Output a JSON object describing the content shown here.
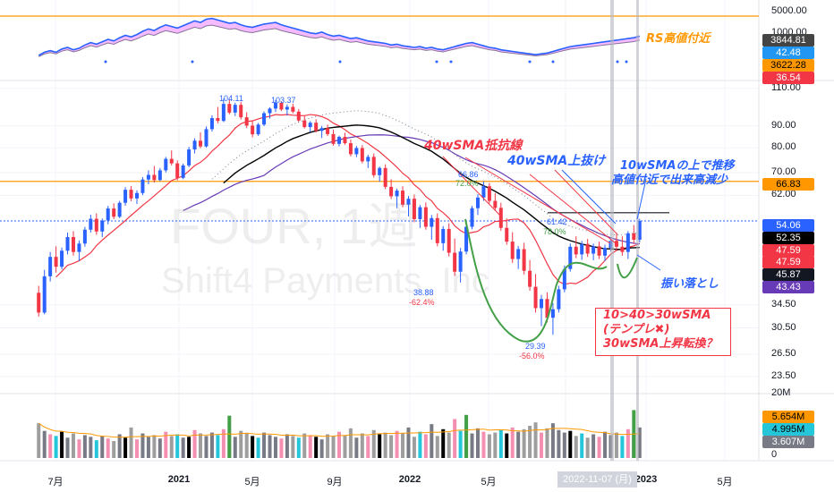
{
  "chart_data": {
    "type": "candlestick",
    "watermark": {
      "symbol": "FOUR, 1週",
      "name": "Shift4 Payments, Inc"
    },
    "price_axis": {
      "ticks": [
        "110.00",
        "90.00",
        "80.00",
        "70.00",
        "62.00",
        "34.50",
        "30.50",
        "26.50",
        "23.50"
      ],
      "scale": "log"
    },
    "rs_axis": {
      "ticks": [
        "5000.00",
        "1000.00"
      ]
    },
    "volume_axis": {
      "ticks": [
        "20M",
        "0"
      ]
    },
    "x_ticks": [
      "7月",
      "2021",
      "5月",
      "9月",
      "2022",
      "5月",
      "9月",
      "2023",
      "5月"
    ],
    "crosshair_date": "2022-11-07",
    "crosshair_extra": "(月)",
    "price_tags": [
      {
        "value": "66.83",
        "bg": "#ff9800",
        "fg": "#000000"
      },
      {
        "value": "54.06",
        "bg": "#2962ff",
        "fg": "#ffffff"
      },
      {
        "value": "52.35",
        "bg": "#000000",
        "fg": "#ffffff"
      },
      {
        "value": "47.59",
        "bg": "#f23645",
        "fg": "#ffffff"
      },
      {
        "value": "47.59",
        "bg": "#f23645",
        "fg": "#ffffff"
      },
      {
        "value": "45.87",
        "bg": "#131722",
        "fg": "#ffffff"
      },
      {
        "value": "43.43",
        "bg": "#673ab7",
        "fg": "#ffffff"
      }
    ],
    "rs_tags": [
      {
        "value": "3844.81",
        "bg": "#444444",
        "fg": "#ffffff"
      },
      {
        "value": "42.48",
        "bg": "#2196f3",
        "fg": "#ffffff"
      },
      {
        "value": "3622.28",
        "bg": "#ff9800",
        "fg": "#000000"
      },
      {
        "value": "36.54",
        "bg": "#f23645",
        "fg": "#ffffff"
      }
    ],
    "volume_tags": [
      {
        "value": "5.654M",
        "bg": "#ff9800",
        "fg": "#000000"
      },
      {
        "value": "4.995M",
        "bg": "#26c6da",
        "fg": "#000000"
      },
      {
        "value": "3.607M",
        "bg": "#787b86",
        "fg": "#ffffff"
      }
    ],
    "price_markers": [
      {
        "label": "104.11",
        "value": 104.11
      },
      {
        "label": "103.37",
        "value": 103.37
      },
      {
        "label": "66.86",
        "value": 66.86
      },
      {
        "label": "72.0%",
        "value": 72.0
      },
      {
        "label": "38.88",
        "value": 38.88
      },
      {
        "label": "-62.4%",
        "value": -62.4
      },
      {
        "label": "61.42",
        "value": 61.42
      },
      {
        "label": "78.0%",
        "value": 78.0
      },
      {
        "label": "29.39",
        "value": 29.39
      },
      {
        "label": "-56.0%",
        "value": -56.0
      }
    ],
    "annotations": [
      {
        "text": "RS高値付近",
        "color": "#ff9800"
      },
      {
        "text": "40wSMA抵抗線",
        "color": "#f23645"
      },
      {
        "text": "40wSMA上抜け",
        "color": "#2962ff"
      },
      {
        "text": "10wSMAの上で推移",
        "color": "#2962ff"
      },
      {
        "text": "高値付近で出来高減少",
        "color": "#2962ff"
      },
      {
        "text": "振い落とし",
        "color": "#2962ff"
      },
      {
        "text": "10>40>30wSMA",
        "color": "#f23645"
      },
      {
        "text": "(テンプレ✖)",
        "color": "#f23645"
      },
      {
        "text": "30wSMA上昇転換？",
        "color": "#f23645"
      }
    ],
    "horizontal_lines": [
      {
        "name": "price-resistance",
        "value": 66.83,
        "color": "#ff9800"
      },
      {
        "name": "last-price",
        "value": 54.06,
        "color": "#2962ff"
      },
      {
        "name": "base-top",
        "value": 56.5,
        "color": "#131722"
      }
    ],
    "series": [
      {
        "name": "candles",
        "type": "ohlc"
      },
      {
        "name": "10wSMA",
        "color": "#f23645"
      },
      {
        "name": "30wSMA",
        "color": "#000000"
      },
      {
        "name": "40wSMA",
        "color": "#673ab7"
      },
      {
        "name": "trend",
        "color": "#787b86"
      },
      {
        "name": "cup",
        "color": "#43a047"
      }
    ],
    "candles": [
      [
        36.8,
        38.2,
        32.4,
        33.1
      ],
      [
        33.1,
        41.6,
        32.8,
        40.2
      ],
      [
        40.2,
        45.8,
        39.1,
        44.6
      ],
      [
        44.6,
        47.2,
        41.0,
        42.3
      ],
      [
        42.3,
        46.9,
        41.7,
        46.1
      ],
      [
        46.1,
        50.8,
        45.2,
        49.6
      ],
      [
        49.6,
        51.2,
        44.9,
        45.8
      ],
      [
        45.8,
        48.7,
        43.6,
        47.9
      ],
      [
        47.9,
        52.4,
        47.1,
        51.6
      ],
      [
        51.6,
        55.9,
        50.8,
        54.7
      ],
      [
        54.7,
        56.3,
        50.2,
        51.1
      ],
      [
        51.1,
        54.8,
        49.6,
        54.2
      ],
      [
        54.2,
        58.6,
        53.1,
        57.8
      ],
      [
        57.8,
        59.4,
        54.6,
        55.3
      ],
      [
        55.3,
        60.2,
        54.9,
        59.6
      ],
      [
        59.6,
        64.8,
        58.7,
        63.9
      ],
      [
        63.9,
        65.2,
        60.1,
        61.0
      ],
      [
        61.0,
        63.7,
        59.2,
        62.8
      ],
      [
        62.8,
        68.4,
        62.1,
        67.5
      ],
      [
        67.5,
        70.9,
        65.8,
        69.2
      ],
      [
        69.2,
        72.6,
        66.4,
        67.3
      ],
      [
        67.3,
        71.8,
        66.9,
        70.9
      ],
      [
        70.9,
        76.2,
        70.1,
        75.4
      ],
      [
        75.4,
        78.9,
        72.8,
        73.6
      ],
      [
        73.6,
        74.8,
        67.2,
        68.1
      ],
      [
        68.1,
        73.5,
        67.6,
        72.8
      ],
      [
        72.8,
        80.4,
        72.1,
        79.3
      ],
      [
        79.3,
        84.2,
        77.6,
        83.1
      ],
      [
        83.1,
        86.9,
        79.8,
        80.6
      ],
      [
        80.6,
        89.7,
        80.1,
        88.4
      ],
      [
        88.4,
        95.2,
        87.3,
        93.8
      ],
      [
        93.8,
        99.6,
        91.2,
        92.4
      ],
      [
        92.4,
        104.11,
        91.8,
        101.2
      ],
      [
        101.2,
        103.8,
        95.7,
        96.6
      ],
      [
        96.6,
        101.9,
        94.8,
        100.7
      ],
      [
        100.7,
        102.4,
        93.1,
        94.2
      ],
      [
        94.2,
        96.8,
        88.9,
        90.1
      ],
      [
        90.1,
        92.7,
        84.6,
        86.0
      ],
      [
        86.0,
        91.4,
        85.3,
        90.6
      ],
      [
        90.6,
        97.2,
        89.8,
        96.3
      ],
      [
        96.3,
        99.4,
        93.6,
        98.7
      ],
      [
        98.7,
        103.37,
        96.9,
        101.8
      ],
      [
        101.8,
        102.6,
        97.4,
        98.2
      ],
      [
        98.2,
        100.9,
        95.1,
        99.6
      ],
      [
        99.6,
        101.3,
        96.2,
        97.1
      ],
      [
        97.1,
        98.4,
        91.8,
        92.6
      ],
      [
        92.6,
        94.9,
        88.7,
        89.4
      ],
      [
        89.4,
        92.3,
        87.1,
        91.5
      ],
      [
        91.5,
        93.2,
        86.8,
        87.6
      ],
      [
        87.6,
        89.9,
        84.3,
        88.9
      ],
      [
        88.9,
        90.6,
        85.2,
        86.1
      ],
      [
        86.1,
        88.2,
        80.9,
        81.7
      ],
      [
        81.7,
        85.4,
        80.6,
        84.8
      ],
      [
        84.8,
        86.7,
        81.3,
        82.0
      ],
      [
        82.0,
        83.6,
        76.4,
        77.3
      ],
      [
        77.3,
        80.8,
        76.1,
        79.9
      ],
      [
        79.9,
        81.2,
        73.6,
        74.4
      ],
      [
        74.4,
        77.1,
        71.8,
        76.2
      ],
      [
        76.2,
        77.6,
        68.2,
        69.1
      ],
      [
        69.1,
        72.4,
        66.7,
        71.8
      ],
      [
        71.8,
        73.2,
        64.1,
        64.9
      ],
      [
        64.9,
        67.6,
        60.8,
        61.7
      ],
      [
        61.7,
        64.3,
        57.9,
        63.6
      ],
      [
        63.6,
        65.1,
        58.2,
        59.0
      ],
      [
        59.0,
        61.8,
        55.4,
        60.9
      ],
      [
        60.9,
        62.3,
        53.7,
        54.6
      ],
      [
        54.6,
        58.9,
        52.1,
        58.2
      ],
      [
        58.2,
        59.7,
        51.6,
        52.4
      ],
      [
        52.4,
        55.8,
        48.9,
        54.9
      ],
      [
        54.9,
        56.3,
        47.2,
        48.0
      ],
      [
        48.0,
        52.6,
        46.1,
        51.8
      ],
      [
        51.8,
        53.4,
        44.7,
        45.6
      ],
      [
        45.6,
        49.2,
        40.3,
        41.2
      ],
      [
        41.2,
        46.8,
        38.88,
        45.9
      ],
      [
        45.9,
        53.1,
        45.2,
        52.4
      ],
      [
        52.4,
        58.6,
        51.7,
        57.9
      ],
      [
        57.9,
        62.4,
        55.8,
        61.3
      ],
      [
        61.3,
        66.86,
        60.2,
        65.1
      ],
      [
        65.1,
        66.2,
        59.4,
        60.2
      ],
      [
        60.2,
        62.8,
        57.1,
        58.0
      ],
      [
        58.0,
        59.6,
        51.3,
        52.1
      ],
      [
        52.1,
        54.8,
        47.6,
        48.4
      ],
      [
        48.4,
        50.9,
        43.2,
        44.1
      ],
      [
        44.1,
        47.3,
        41.8,
        46.5
      ],
      [
        46.5,
        48.1,
        40.6,
        41.4
      ],
      [
        41.4,
        43.9,
        37.2,
        38.0
      ],
      [
        38.0,
        40.7,
        33.1,
        33.9
      ],
      [
        33.9,
        36.4,
        30.8,
        35.6
      ],
      [
        35.6,
        36.9,
        31.4,
        32.2
      ],
      [
        32.2,
        34.8,
        29.39,
        33.7
      ],
      [
        33.7,
        38.2,
        33.1,
        37.5
      ],
      [
        37.5,
        42.6,
        36.9,
        41.8
      ],
      [
        41.8,
        47.9,
        41.2,
        47.1
      ],
      [
        47.1,
        49.8,
        44.3,
        45.2
      ],
      [
        45.2,
        48.6,
        43.9,
        47.8
      ],
      [
        47.8,
        49.1,
        44.6,
        45.4
      ],
      [
        45.4,
        47.9,
        43.8,
        47.2
      ],
      [
        47.2,
        48.4,
        44.1,
        44.9
      ],
      [
        44.9,
        47.6,
        43.6,
        46.8
      ],
      [
        46.8,
        49.3,
        45.9,
        48.6
      ],
      [
        48.6,
        50.4,
        46.2,
        47.1
      ],
      [
        47.1,
        49.8,
        44.9,
        45.8
      ],
      [
        45.8,
        51.2,
        44.1,
        50.6
      ],
      [
        50.6,
        52.9,
        47.8,
        48.9
      ],
      [
        48.9,
        54.7,
        48.2,
        54.06
      ]
    ],
    "volume": [
      4.1,
      3.2,
      2.8,
      2.6,
      3.1,
      2.4,
      2.9,
      2.2,
      2.7,
      2.5,
      2.1,
      2.6,
      2.3,
      2.0,
      2.8,
      2.4,
      3.6,
      2.2,
      2.9,
      2.5,
      2.7,
      2.3,
      3.1,
      2.6,
      2.8,
      2.4,
      2.5,
      3.3,
      2.9,
      2.6,
      3.0,
      2.7,
      3.4,
      2.8,
      2.5,
      3.2,
      2.9,
      2.6,
      2.4,
      3.0,
      2.7,
      2.5,
      2.3,
      2.8,
      2.6,
      2.4,
      2.9,
      2.7,
      2.5,
      2.2,
      2.8,
      2.6,
      3.1,
      2.7,
      3.5,
      2.4,
      2.9,
      2.6,
      3.3,
      2.8,
      3.0,
      2.7,
      3.2,
      2.9,
      3.6,
      2.5,
      3.1,
      2.8,
      4.0,
      2.6,
      3.4,
      3.0,
      4.6,
      3.2,
      3.8,
      2.9,
      3.5,
      3.1,
      2.8,
      3.0,
      3.3,
      2.9,
      3.6,
      3.1,
      3.4,
      3.8,
      4.2,
      3.0,
      3.5,
      4.1,
      3.3,
      3.0,
      3.2,
      2.6,
      2.9,
      2.4,
      2.8,
      2.5,
      3.1,
      2.7,
      3.0,
      2.6,
      3.4,
      2.9,
      3.607
    ],
    "volume_highlight": {
      "peak": 5.654,
      "mid": 4.995
    },
    "rs_line": [
      20,
      24,
      26,
      24,
      28,
      30,
      27,
      29,
      33,
      36,
      34,
      37,
      40,
      38,
      42,
      45,
      43,
      46,
      50,
      53,
      51,
      55,
      58,
      56,
      54,
      57,
      60,
      63,
      61,
      65,
      66,
      64,
      62,
      60,
      61,
      58,
      56,
      55,
      57,
      59,
      60,
      61,
      58,
      56,
      54,
      52,
      50,
      48,
      47,
      49,
      46,
      44,
      45,
      43,
      41,
      42,
      40,
      38,
      37,
      36,
      35,
      33,
      34,
      32,
      31,
      30,
      31,
      29,
      30,
      28,
      27,
      29,
      31,
      33,
      35,
      36,
      34,
      32,
      30,
      29,
      27,
      26,
      25,
      24,
      23,
      22,
      21,
      22,
      23,
      25,
      27,
      29,
      31,
      32,
      33,
      34,
      35,
      36,
      37,
      38,
      39,
      40,
      41,
      42,
      44
    ],
    "rs_band_top": 60
  }
}
